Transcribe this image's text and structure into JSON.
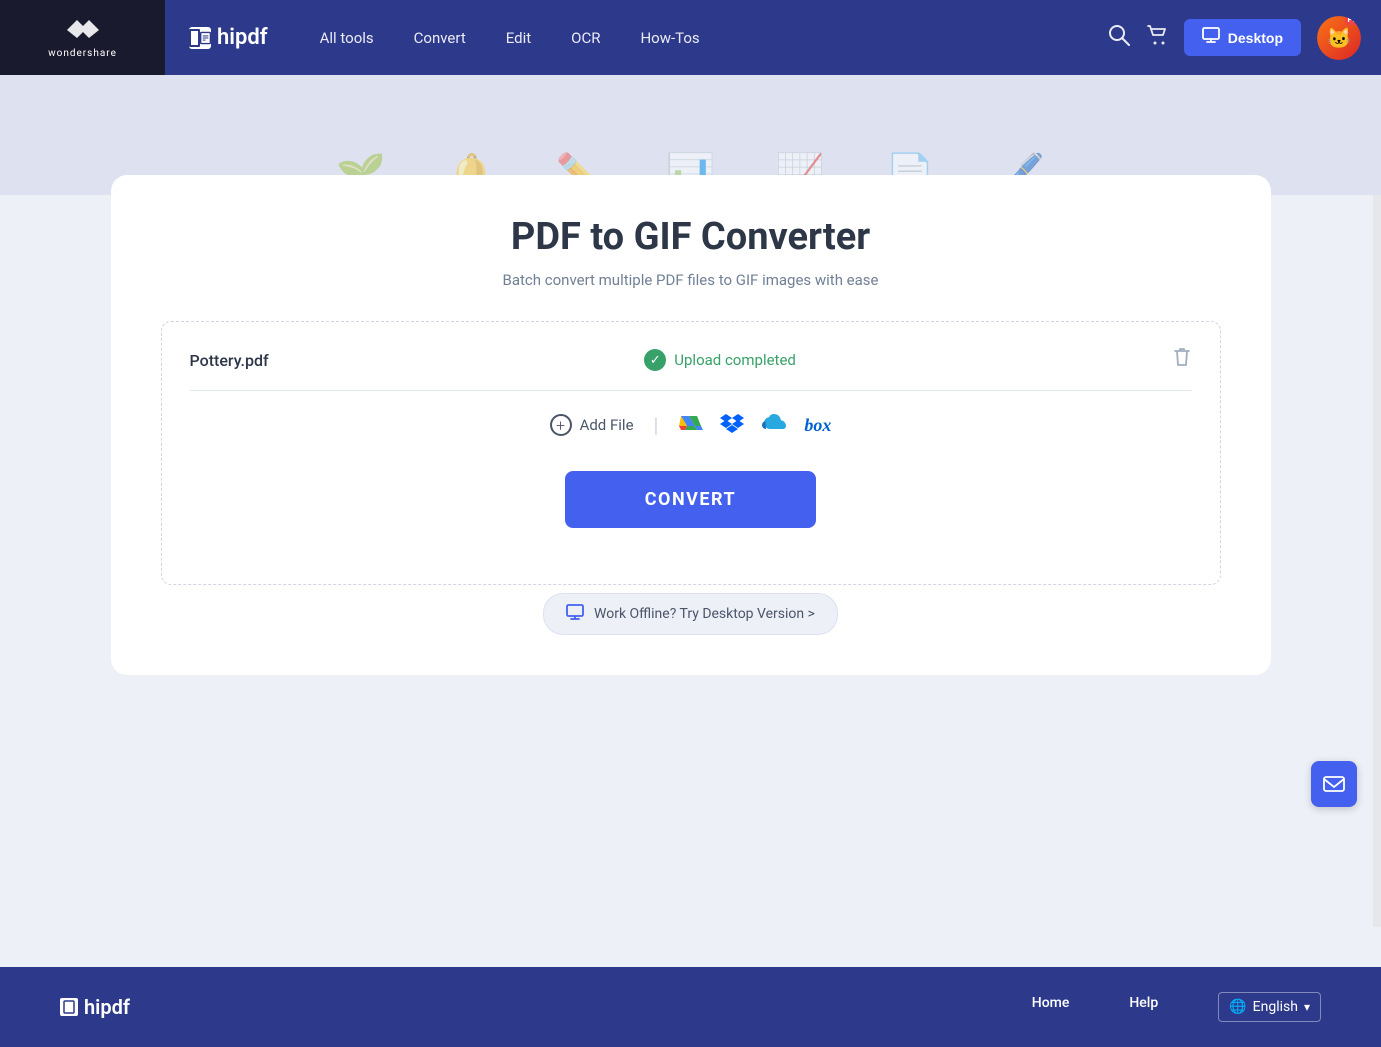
{
  "brand": {
    "wondershare_label": "wondershare",
    "hipdf_label": "hipdf"
  },
  "navbar": {
    "all_tools": "All tools",
    "convert": "Convert",
    "edit": "Edit",
    "ocr": "OCR",
    "how_tos": "How-Tos",
    "desktop_btn": "Desktop"
  },
  "hero": {
    "icons": [
      "🌱",
      "🔔",
      "✏️",
      "📊",
      "📈",
      "📄",
      "🖊️"
    ]
  },
  "converter": {
    "title": "PDF to GIF Converter",
    "subtitle": "Batch convert multiple PDF files to GIF images with ease",
    "file_name": "Pottery.pdf",
    "upload_status": "Upload completed",
    "add_file_label": "Add File",
    "convert_btn": "CONVERT",
    "desktop_banner": "Work Offline? Try Desktop Version >"
  },
  "footer": {
    "hipdf_label": "hipdf",
    "home_label": "Home",
    "help_label": "Help",
    "language_label": "English"
  }
}
